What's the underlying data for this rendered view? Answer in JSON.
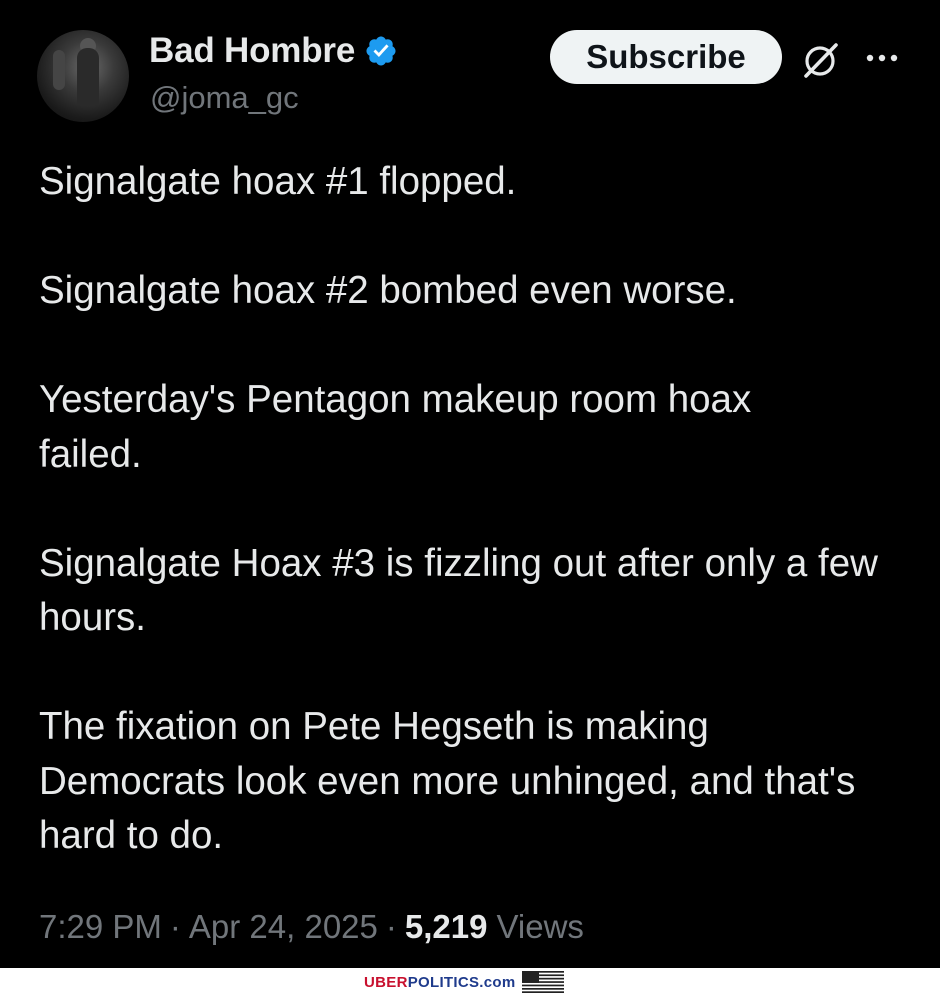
{
  "author": {
    "display_name": "Bad Hombre",
    "handle": "@joma_gc",
    "verified_icon": "verified-badge-icon",
    "verified_color": "#1d9bf0"
  },
  "actions": {
    "subscribe_label": "Subscribe",
    "grok_icon": "grok-icon",
    "more_icon": "more-options-icon"
  },
  "post": {
    "paragraphs": [
      "Signalgate hoax #1 flopped.",
      "Signalgate hoax #2 bombed even worse.",
      "Yesterday's Pentagon makeup room hoax failed.",
      "Signalgate Hoax #3 is fizzling out after only a few hours.",
      "The fixation on Pete Hegseth is making Democrats look even more unhinged, and that's hard to do."
    ]
  },
  "meta": {
    "time": "7:29 PM",
    "separator": "·",
    "date": "Apr 24, 2025",
    "views_count": "5,219",
    "views_label": "Views"
  },
  "watermark": {
    "part1": "UBER",
    "part2": "POLITICS",
    "part3": ".com",
    "flag_icon": "us-flag-icon"
  },
  "colors": {
    "background": "#000000",
    "text": "#e7e9ea",
    "muted": "#71767b",
    "subscribe_bg": "#eff3f4"
  }
}
